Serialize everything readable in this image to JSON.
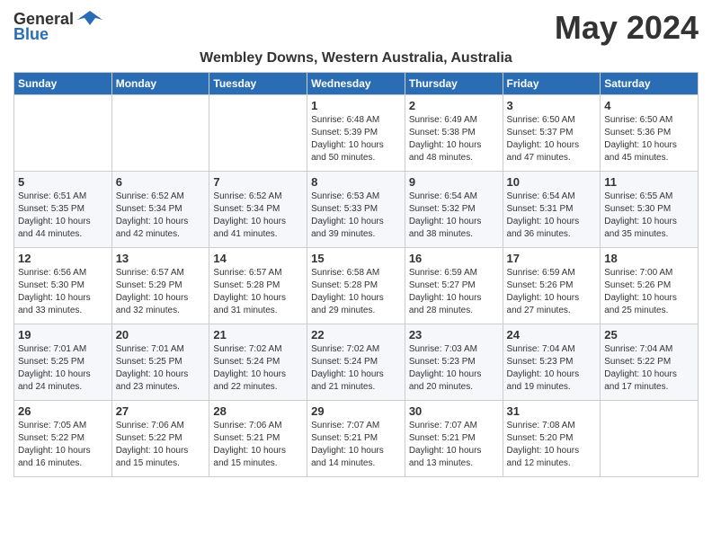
{
  "header": {
    "logo_general": "General",
    "logo_blue": "Blue",
    "month_title": "May 2024",
    "location": "Wembley Downs, Western Australia, Australia"
  },
  "columns": [
    "Sunday",
    "Monday",
    "Tuesday",
    "Wednesday",
    "Thursday",
    "Friday",
    "Saturday"
  ],
  "weeks": [
    [
      {
        "day": "",
        "info": ""
      },
      {
        "day": "",
        "info": ""
      },
      {
        "day": "",
        "info": ""
      },
      {
        "day": "1",
        "info": "Sunrise: 6:48 AM\nSunset: 5:39 PM\nDaylight: 10 hours\nand 50 minutes."
      },
      {
        "day": "2",
        "info": "Sunrise: 6:49 AM\nSunset: 5:38 PM\nDaylight: 10 hours\nand 48 minutes."
      },
      {
        "day": "3",
        "info": "Sunrise: 6:50 AM\nSunset: 5:37 PM\nDaylight: 10 hours\nand 47 minutes."
      },
      {
        "day": "4",
        "info": "Sunrise: 6:50 AM\nSunset: 5:36 PM\nDaylight: 10 hours\nand 45 minutes."
      }
    ],
    [
      {
        "day": "5",
        "info": "Sunrise: 6:51 AM\nSunset: 5:35 PM\nDaylight: 10 hours\nand 44 minutes."
      },
      {
        "day": "6",
        "info": "Sunrise: 6:52 AM\nSunset: 5:34 PM\nDaylight: 10 hours\nand 42 minutes."
      },
      {
        "day": "7",
        "info": "Sunrise: 6:52 AM\nSunset: 5:34 PM\nDaylight: 10 hours\nand 41 minutes."
      },
      {
        "day": "8",
        "info": "Sunrise: 6:53 AM\nSunset: 5:33 PM\nDaylight: 10 hours\nand 39 minutes."
      },
      {
        "day": "9",
        "info": "Sunrise: 6:54 AM\nSunset: 5:32 PM\nDaylight: 10 hours\nand 38 minutes."
      },
      {
        "day": "10",
        "info": "Sunrise: 6:54 AM\nSunset: 5:31 PM\nDaylight: 10 hours\nand 36 minutes."
      },
      {
        "day": "11",
        "info": "Sunrise: 6:55 AM\nSunset: 5:30 PM\nDaylight: 10 hours\nand 35 minutes."
      }
    ],
    [
      {
        "day": "12",
        "info": "Sunrise: 6:56 AM\nSunset: 5:30 PM\nDaylight: 10 hours\nand 33 minutes."
      },
      {
        "day": "13",
        "info": "Sunrise: 6:57 AM\nSunset: 5:29 PM\nDaylight: 10 hours\nand 32 minutes."
      },
      {
        "day": "14",
        "info": "Sunrise: 6:57 AM\nSunset: 5:28 PM\nDaylight: 10 hours\nand 31 minutes."
      },
      {
        "day": "15",
        "info": "Sunrise: 6:58 AM\nSunset: 5:28 PM\nDaylight: 10 hours\nand 29 minutes."
      },
      {
        "day": "16",
        "info": "Sunrise: 6:59 AM\nSunset: 5:27 PM\nDaylight: 10 hours\nand 28 minutes."
      },
      {
        "day": "17",
        "info": "Sunrise: 6:59 AM\nSunset: 5:26 PM\nDaylight: 10 hours\nand 27 minutes."
      },
      {
        "day": "18",
        "info": "Sunrise: 7:00 AM\nSunset: 5:26 PM\nDaylight: 10 hours\nand 25 minutes."
      }
    ],
    [
      {
        "day": "19",
        "info": "Sunrise: 7:01 AM\nSunset: 5:25 PM\nDaylight: 10 hours\nand 24 minutes."
      },
      {
        "day": "20",
        "info": "Sunrise: 7:01 AM\nSunset: 5:25 PM\nDaylight: 10 hours\nand 23 minutes."
      },
      {
        "day": "21",
        "info": "Sunrise: 7:02 AM\nSunset: 5:24 PM\nDaylight: 10 hours\nand 22 minutes."
      },
      {
        "day": "22",
        "info": "Sunrise: 7:02 AM\nSunset: 5:24 PM\nDaylight: 10 hours\nand 21 minutes."
      },
      {
        "day": "23",
        "info": "Sunrise: 7:03 AM\nSunset: 5:23 PM\nDaylight: 10 hours\nand 20 minutes."
      },
      {
        "day": "24",
        "info": "Sunrise: 7:04 AM\nSunset: 5:23 PM\nDaylight: 10 hours\nand 19 minutes."
      },
      {
        "day": "25",
        "info": "Sunrise: 7:04 AM\nSunset: 5:22 PM\nDaylight: 10 hours\nand 17 minutes."
      }
    ],
    [
      {
        "day": "26",
        "info": "Sunrise: 7:05 AM\nSunset: 5:22 PM\nDaylight: 10 hours\nand 16 minutes."
      },
      {
        "day": "27",
        "info": "Sunrise: 7:06 AM\nSunset: 5:22 PM\nDaylight: 10 hours\nand 15 minutes."
      },
      {
        "day": "28",
        "info": "Sunrise: 7:06 AM\nSunset: 5:21 PM\nDaylight: 10 hours\nand 15 minutes."
      },
      {
        "day": "29",
        "info": "Sunrise: 7:07 AM\nSunset: 5:21 PM\nDaylight: 10 hours\nand 14 minutes."
      },
      {
        "day": "30",
        "info": "Sunrise: 7:07 AM\nSunset: 5:21 PM\nDaylight: 10 hours\nand 13 minutes."
      },
      {
        "day": "31",
        "info": "Sunrise: 7:08 AM\nSunset: 5:20 PM\nDaylight: 10 hours\nand 12 minutes."
      },
      {
        "day": "",
        "info": ""
      }
    ]
  ]
}
